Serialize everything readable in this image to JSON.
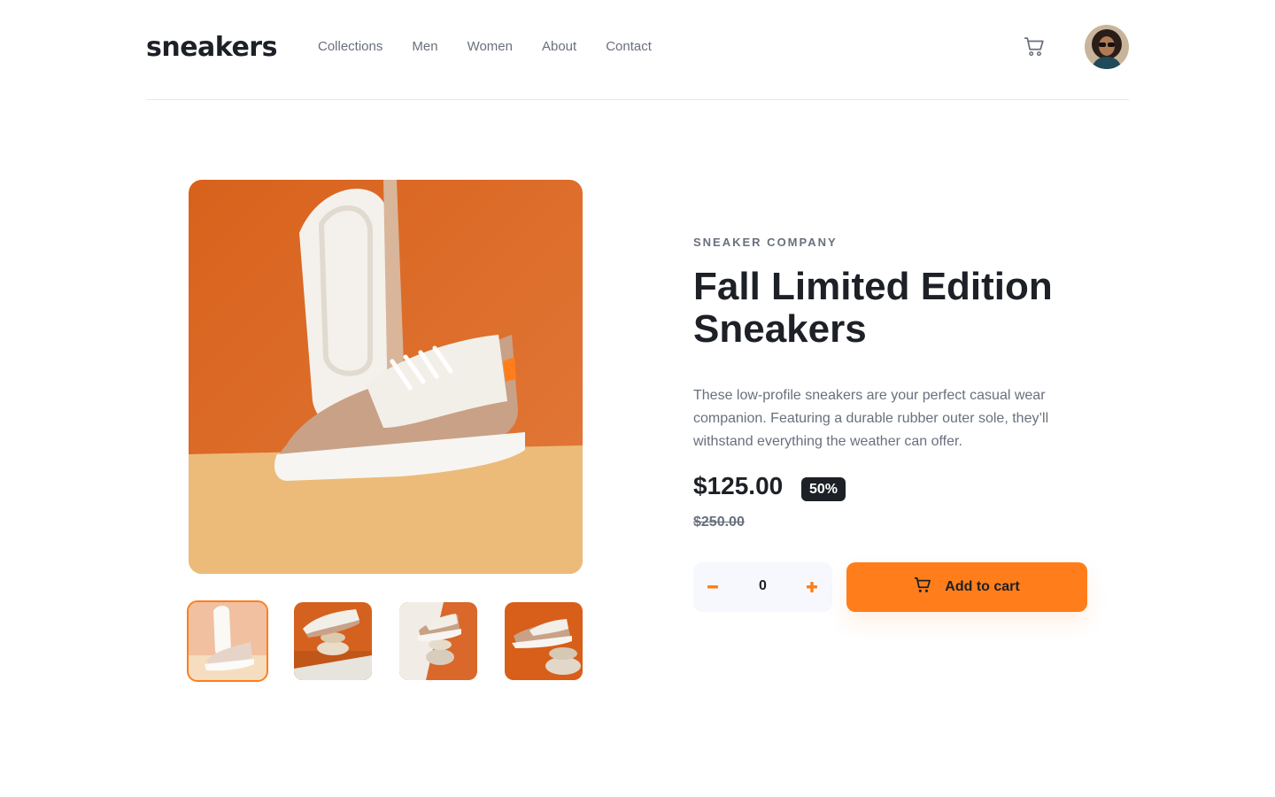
{
  "header": {
    "logo": "sneakers",
    "nav": [
      "Collections",
      "Men",
      "Women",
      "About",
      "Contact"
    ]
  },
  "product": {
    "company": "SNEAKER COMPANY",
    "title": "Fall Limited Edition Sneakers",
    "description": "These low-profile sneakers are your perfect casual wear companion. Featuring a durable rubber outer sole, they’ll withstand everything the weather can offer.",
    "price": "$125.00",
    "discount": "50%",
    "old_price": "$250.00"
  },
  "cart": {
    "quantity": "0",
    "add_label": "Add to cart"
  },
  "colors": {
    "accent": "#ff7e1b",
    "dark": "#1d2026",
    "text_muted": "#69707d",
    "light_bg": "#f6f8fd"
  }
}
